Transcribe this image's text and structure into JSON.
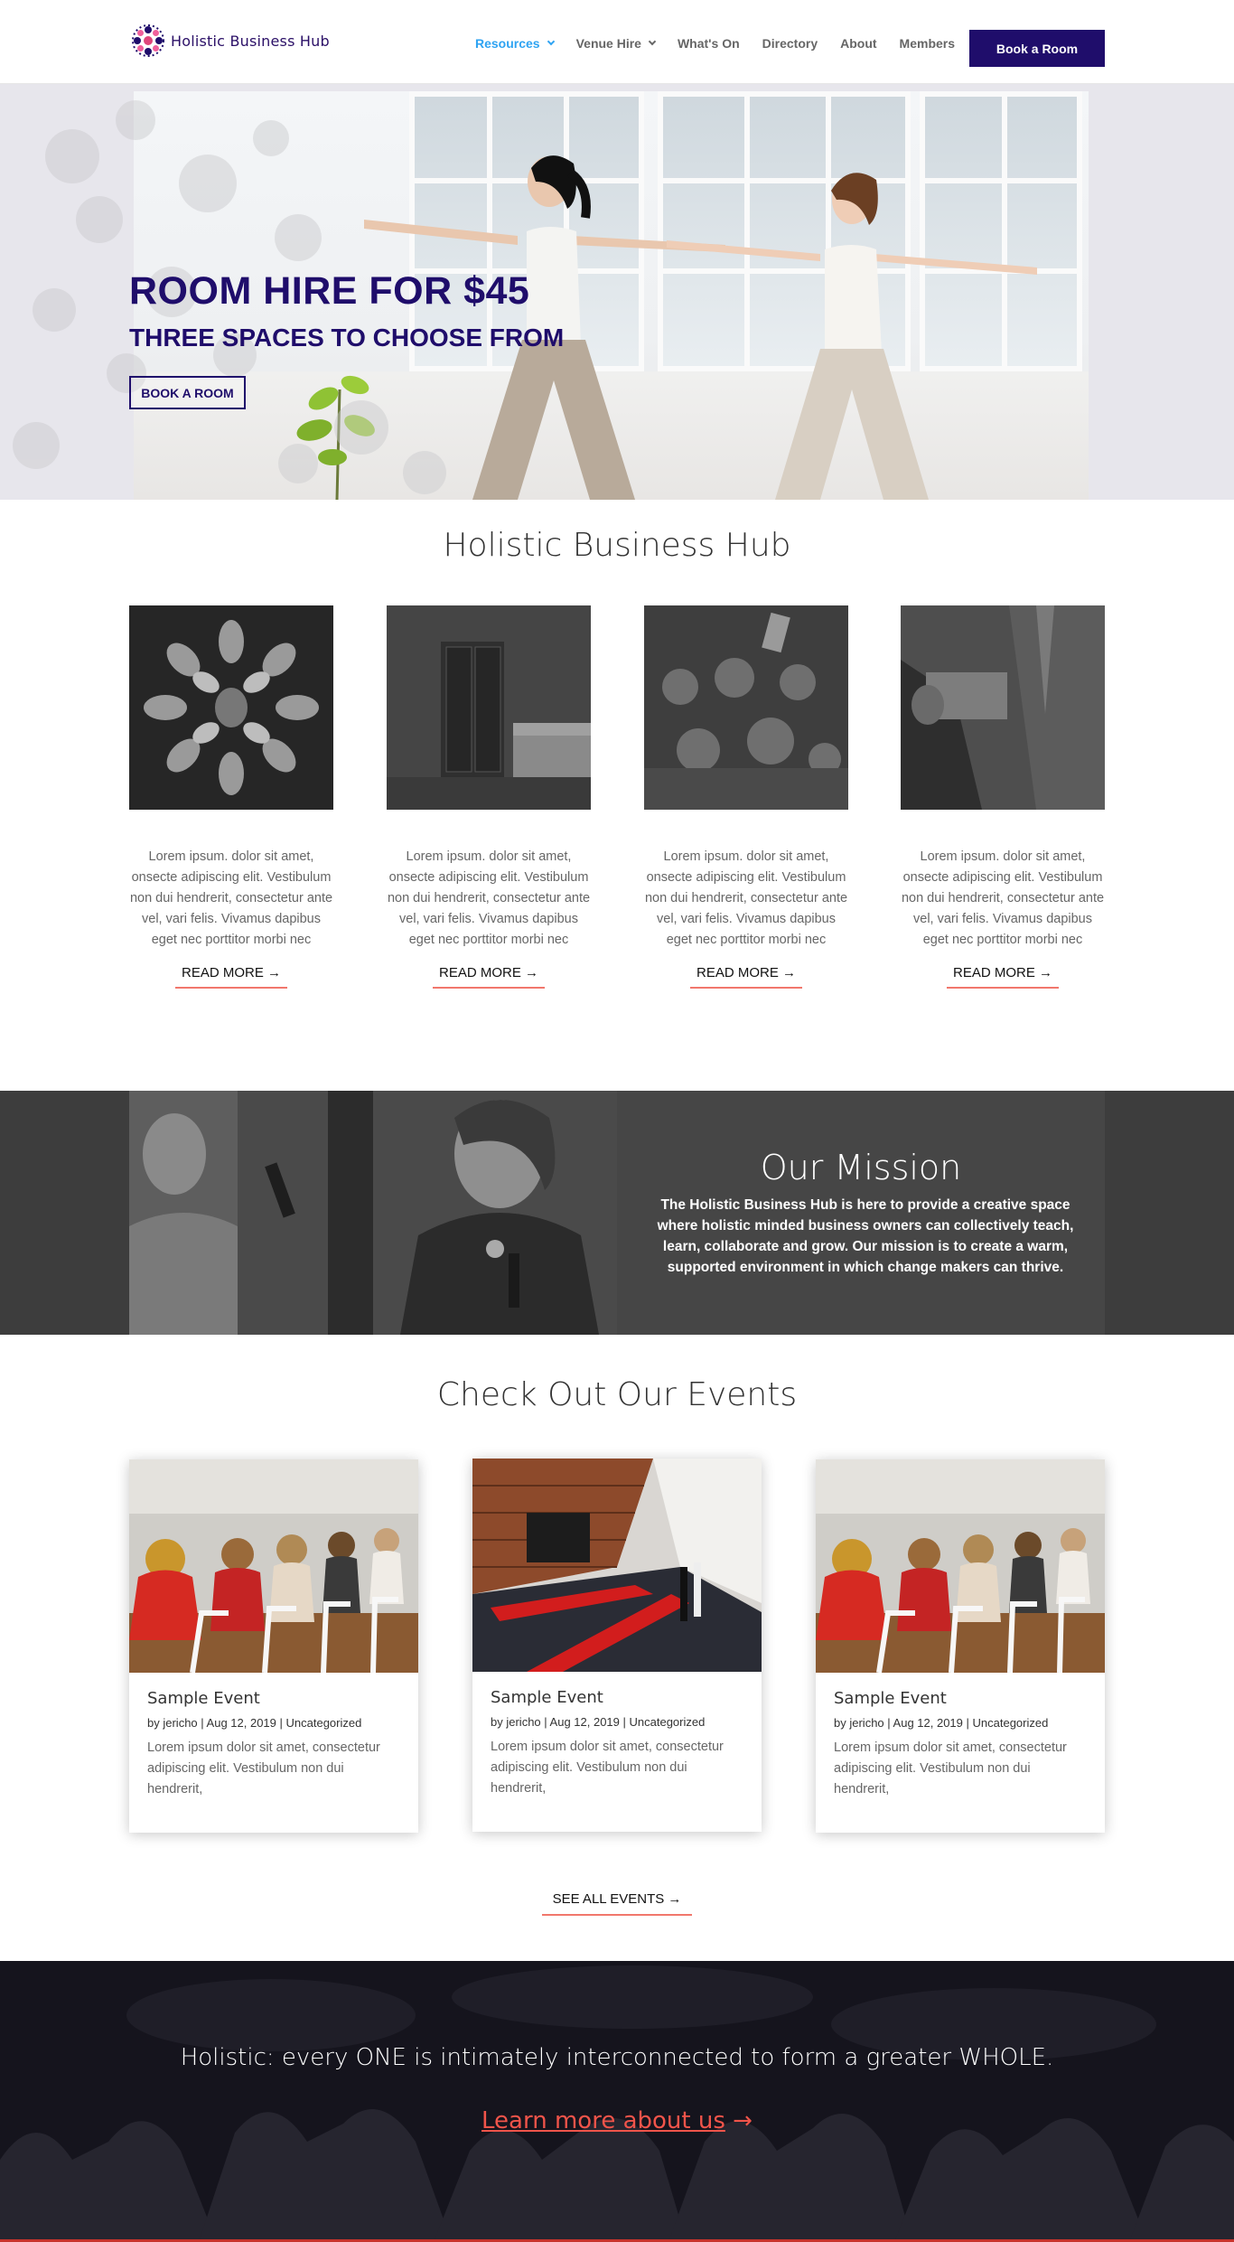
{
  "header": {
    "brand": "Holistic Business Hub",
    "nav": [
      {
        "label": "Resources",
        "active": true,
        "dropdown": true
      },
      {
        "label": "Venue Hire",
        "active": false,
        "dropdown": true
      },
      {
        "label": "What's On",
        "active": false,
        "dropdown": false
      },
      {
        "label": "Directory",
        "active": false,
        "dropdown": false
      },
      {
        "label": "About",
        "active": false,
        "dropdown": false
      },
      {
        "label": "Members",
        "active": false,
        "dropdown": false
      }
    ],
    "cta_label": "Book a Room"
  },
  "hero": {
    "title": "ROOM HIRE FOR $45",
    "subtitle": "THREE SPACES TO CHOOSE FROM",
    "button_label": "BOOK A ROOM"
  },
  "intro": {
    "title": "Holistic Business Hub",
    "cards": [
      {
        "text": "Lorem ipsum. dolor sit amet, onsecte adipiscing elit. Vestibulum non dui hendrerit, consectetur ante vel, vari felis. Vivamus dapibus eget nec porttitor morbi nec",
        "link": "READ MORE"
      },
      {
        "text": "Lorem ipsum. dolor sit amet, onsecte adipiscing elit. Vestibulum non dui hendrerit, consectetur ante vel, vari felis. Vivamus dapibus eget nec porttitor morbi nec",
        "link": "READ MORE"
      },
      {
        "text": "Lorem ipsum. dolor sit amet, onsecte adipiscing elit. Vestibulum non dui hendrerit, consectetur ante vel, vari felis. Vivamus dapibus eget nec porttitor morbi nec",
        "link": "READ MORE"
      },
      {
        "text": "Lorem ipsum. dolor sit amet, onsecte adipiscing elit. Vestibulum non dui hendrerit, consectetur ante vel, vari felis. Vivamus dapibus eget nec porttitor morbi nec",
        "link": "READ MORE"
      }
    ]
  },
  "mission": {
    "title": "Our Mission",
    "text": "The Holistic Business Hub is here to provide a creative space where holistic minded business owners can collectively teach, learn, collaborate and grow. Our mission is to create a warm, supported environment in which change makers can thrive."
  },
  "events": {
    "title": "Check Out Our Events",
    "items": [
      {
        "title": "Sample Event",
        "author": "jericho",
        "date": "Aug 12, 2019",
        "category": "Uncategorized",
        "excerpt": "Lorem ipsum dolor sit amet, consectetur adipiscing elit. Vestibulum non dui hendrerit,"
      },
      {
        "title": "Sample Event",
        "author": "jericho",
        "date": "Aug 12, 2019",
        "category": "Uncategorized",
        "excerpt": "Lorem ipsum dolor sit amet, consectetur adipiscing elit. Vestibulum non dui hendrerit,"
      },
      {
        "title": "Sample Event",
        "author": "jericho",
        "date": "Aug 12, 2019",
        "category": "Uncategorized",
        "excerpt": "Lorem ipsum dolor sit amet, consectetur adipiscing elit. Vestibulum non dui hendrerit,"
      }
    ],
    "see_all": "SEE ALL EVENTS",
    "meta_prefix": "by"
  },
  "band": {
    "quote": "Holistic: every ONE is intimately interconnected to form a greater WHOLE.",
    "link": "Learn more about us"
  },
  "colors": {
    "brand": "#1f0d6b",
    "nav_active": "#2ea3f2",
    "accent": "#f1776c"
  }
}
